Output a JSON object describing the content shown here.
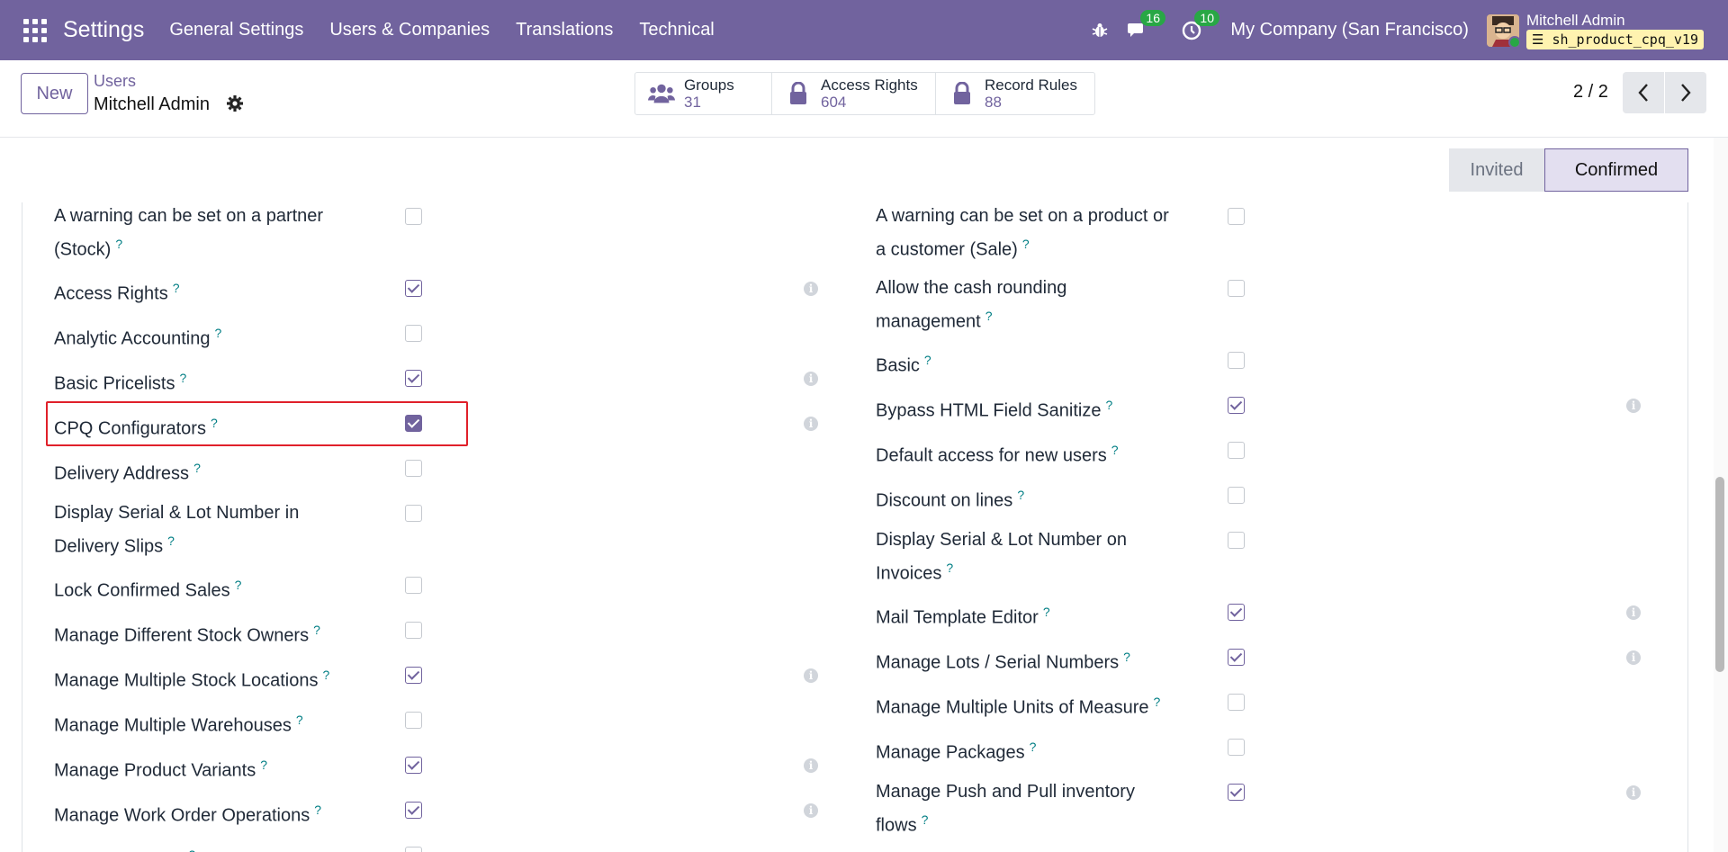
{
  "navbar": {
    "app_title": "Settings",
    "menu": [
      "General Settings",
      "Users & Companies",
      "Translations",
      "Technical"
    ],
    "messages_count": "16",
    "activities_count": "10",
    "company": "My Company (San Francisco)",
    "user_name": "Mitchell Admin",
    "database": "sh_product_cpq_v19"
  },
  "control": {
    "new_label": "New",
    "breadcrumb_parent": "Users",
    "breadcrumb_current": "Mitchell Admin",
    "smart_buttons": [
      {
        "label": "Groups",
        "value": "31",
        "icon": "users-icon"
      },
      {
        "label": "Access Rights",
        "value": "604",
        "icon": "lock-icon"
      },
      {
        "label": "Record Rules",
        "value": "88",
        "icon": "lock-icon"
      }
    ],
    "pager": "2 / 2"
  },
  "statusbar": {
    "stages": [
      "Invited",
      "Confirmed"
    ],
    "active": "Confirmed"
  },
  "left_fields": [
    {
      "label_lines": [
        "A warning can be set on a partner",
        "(Stock)"
      ],
      "checked": false
    },
    {
      "label_lines": [
        "Access Rights"
      ],
      "checked": true
    },
    {
      "label_lines": [
        "Analytic Accounting"
      ],
      "checked": false
    },
    {
      "label_lines": [
        "Basic Pricelists"
      ],
      "checked": true
    },
    {
      "label_lines": [
        "CPQ Configurators"
      ],
      "checked": true
    },
    {
      "label_lines": [
        "Delivery Address"
      ],
      "checked": false
    },
    {
      "label_lines": [
        "Display Serial & Lot Number in",
        "Delivery Slips"
      ],
      "checked": false
    },
    {
      "label_lines": [
        "Lock Confirmed Sales"
      ],
      "checked": false
    },
    {
      "label_lines": [
        "Manage Different Stock Owners"
      ],
      "checked": false
    },
    {
      "label_lines": [
        "Manage Multiple Stock Locations"
      ],
      "checked": true
    },
    {
      "label_lines": [
        "Manage Multiple Warehouses"
      ],
      "checked": false
    },
    {
      "label_lines": [
        "Manage Product Variants"
      ],
      "checked": true
    },
    {
      "label_lines": [
        "Manage Work Order Operations"
      ],
      "checked": true
    },
    {
      "label_lines": [
        "Multi Currencies"
      ],
      "checked": false
    }
  ],
  "right_fields": [
    {
      "label_lines": [
        "A warning can be set on a product or",
        "a customer (Sale)"
      ],
      "checked": false
    },
    {
      "label_lines": [
        "Allow the cash rounding",
        "management"
      ],
      "checked": false
    },
    {
      "label_lines": [
        "Basic"
      ],
      "checked": false
    },
    {
      "label_lines": [
        "Bypass HTML Field Sanitize"
      ],
      "checked": true
    },
    {
      "label_lines": [
        "Default access for new users"
      ],
      "checked": false
    },
    {
      "label_lines": [
        "Discount on lines"
      ],
      "checked": false
    },
    {
      "label_lines": [
        "Display Serial & Lot Number on",
        "Invoices"
      ],
      "checked": false
    },
    {
      "label_lines": [
        "Mail Template Editor"
      ],
      "checked": true
    },
    {
      "label_lines": [
        "Manage Lots / Serial Numbers"
      ],
      "checked": true
    },
    {
      "label_lines": [
        "Manage Multiple Units of Measure"
      ],
      "checked": false
    },
    {
      "label_lines": [
        "Manage Packages"
      ],
      "checked": false
    },
    {
      "label_lines": [
        "Manage Push and Pull inventory",
        "flows"
      ],
      "checked": true
    }
  ],
  "help_mark": "?",
  "info_mark": "i",
  "colors": {
    "brand": "#71639e",
    "badge": "#28a745",
    "highlight": "#e0202a",
    "help": "#017e84"
  }
}
